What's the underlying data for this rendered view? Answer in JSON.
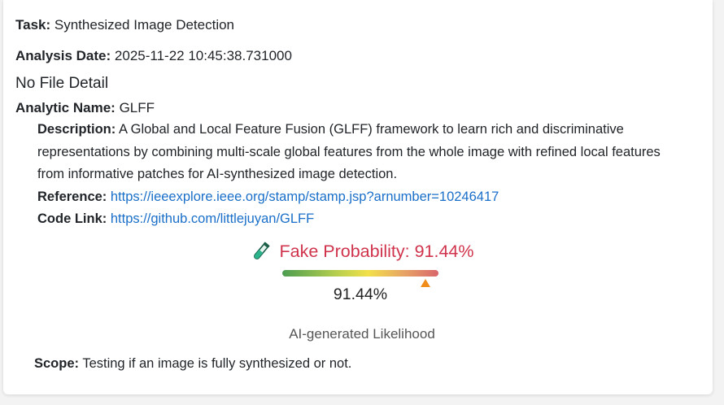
{
  "task": {
    "label": "Task:",
    "value": "Synthesized Image Detection"
  },
  "analysis_date": {
    "label": "Analysis Date:",
    "value": "2025-11-22 10:45:38.731000"
  },
  "file_detail": "No File Detail",
  "analytic": {
    "label": "Analytic Name:",
    "value": "GLFF",
    "description_label": "Description:",
    "description": "A Global and Local Feature Fusion (GLFF) framework to learn rich and discriminative representations by combining multi-scale global features from the whole image with refined local features from informative patches for AI-synthesized image detection.",
    "reference_label": "Reference:",
    "reference_url": "https://ieeexplore.ieee.org/stamp/stamp.jsp?arnumber=10246417",
    "code_label": "Code Link:",
    "code_url": "https://github.com/littlejuyan/GLFF"
  },
  "result": {
    "icon": "test-tube-icon",
    "title": "Fake Probability: 91.44%",
    "probability": 0.9144,
    "percent_text": "91.44%",
    "caption": "AI-generated Likelihood",
    "title_color": "#d0344d",
    "marker_color": "#f08c1a"
  },
  "scope": {
    "label": "Scope:",
    "value": "Testing if an image is fully synthesized or not."
  }
}
